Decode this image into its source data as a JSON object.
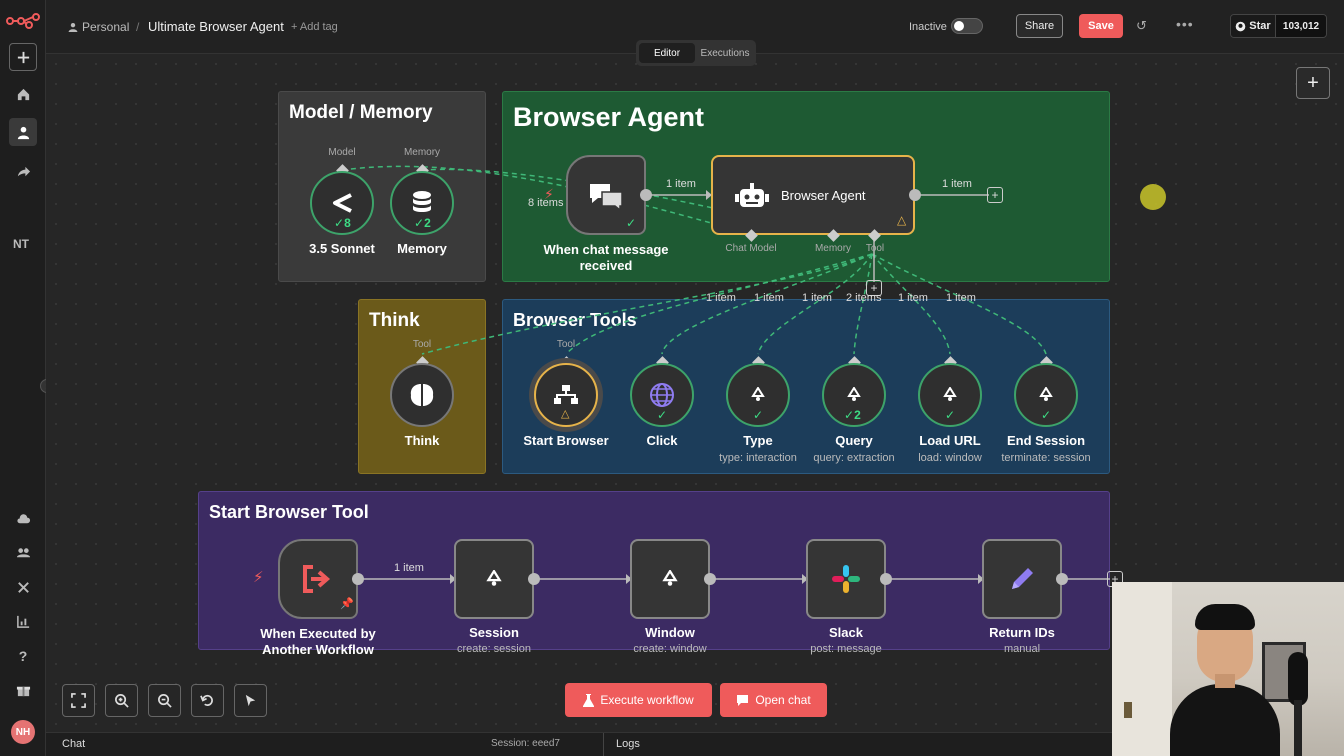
{
  "header": {
    "project": "Personal",
    "separator": "/",
    "workflow_name": "Ultimate Browser Agent",
    "add_tag": "+ Add tag",
    "status_label": "Inactive",
    "share_label": "Share",
    "save_label": "Save",
    "github_star_label": "Star",
    "github_star_count": "103,012"
  },
  "tabs": [
    {
      "label": "Editor",
      "active": true
    },
    {
      "label": "Executions",
      "active": false
    }
  ],
  "sidebar": {
    "items": [
      "add",
      "home",
      "personal",
      "shared",
      "NT",
      "cloud",
      "community",
      "variables",
      "insights",
      "help",
      "whats-new"
    ],
    "nt_label": "NT",
    "avatar_initials": "NH"
  },
  "stickies": {
    "model_memory": "Model / Memory",
    "browser_agent": "Browser Agent",
    "think": "Think",
    "browser_tools": "Browser Tools",
    "start_browser_tool": "Start Browser Tool"
  },
  "colors": {
    "model_memory_bg": "#3a3a3a",
    "browser_agent_bg": "#1e5a33",
    "think_bg": "#6b5a1a",
    "browser_tools_bg": "#1c3d5a",
    "start_browser_bg": "#3c2b63",
    "accent": "#ef5b5b",
    "success": "#3da36a"
  },
  "nodes": {
    "model": {
      "port": "Model",
      "label": "3.5 Sonnet",
      "count": "8",
      "icon": "anthropic-icon"
    },
    "memory": {
      "port": "Memory",
      "label": "Memory",
      "count": "2",
      "icon": "database-icon"
    },
    "chat_trigger": {
      "label_line1": "When chat message",
      "label_line2": "received",
      "items": "8 items",
      "icon": "chat-bubbles-icon"
    },
    "agent": {
      "label": "Browser Agent",
      "port_chat_model": "Chat Model",
      "port_memory": "Memory",
      "port_tool": "Tool",
      "icon": "robot-icon"
    },
    "think": {
      "port": "Tool",
      "label": "Think",
      "icon": "brain-icon"
    },
    "start_browser": {
      "port": "Tool",
      "label": "Start Browser",
      "icon": "sitemap-icon"
    },
    "click": {
      "label": "Click",
      "icon": "globe-icon"
    },
    "type": {
      "label": "Type",
      "sub": "type: interaction",
      "icon": "recycle-icon"
    },
    "query": {
      "label": "Query",
      "sub": "query: extraction",
      "count": "2",
      "icon": "recycle-icon"
    },
    "load_url": {
      "label": "Load URL",
      "sub": "load: window",
      "icon": "recycle-icon"
    },
    "end_session": {
      "label": "End Session",
      "sub": "terminate: session",
      "icon": "recycle-icon"
    },
    "executed_trigger": {
      "label_line1": "When Executed by",
      "label_line2": "Another Workflow",
      "icon": "sign-in-icon"
    },
    "session": {
      "label": "Session",
      "sub": "create: session",
      "icon": "recycle-icon"
    },
    "window": {
      "label": "Window",
      "sub": "create: window",
      "icon": "recycle-icon"
    },
    "slack": {
      "label": "Slack",
      "sub": "post: message",
      "icon": "slack-icon"
    },
    "return_ids": {
      "label": "Return IDs",
      "sub": "manual",
      "icon": "pencil-icon"
    }
  },
  "connections": {
    "chat_to_agent": "1 item",
    "agent_out": "1 item",
    "trigger_to_session": "1 item",
    "tool_click": "1 item",
    "tool_type": "1 item",
    "tool_query_a": "1 item",
    "tool_query_b": "2 items",
    "tool_load": "1 item",
    "tool_end": "1 item"
  },
  "actions": {
    "execute_label": "Execute workflow",
    "open_chat_label": "Open chat"
  },
  "bottom_bar": {
    "chat_label": "Chat",
    "session_label": "Session: eeed7",
    "logs_label": "Logs"
  }
}
